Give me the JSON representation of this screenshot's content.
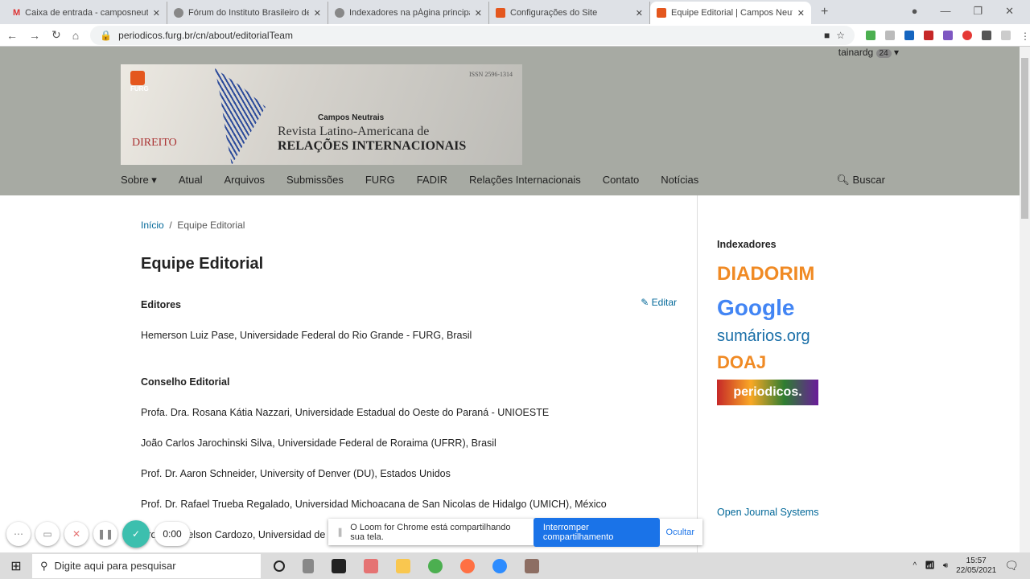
{
  "browser": {
    "tabs": [
      {
        "title": "Caixa de entrada - camposneutr",
        "icon": "gmail-icon"
      },
      {
        "title": "Fórum do Instituto Brasileiro de",
        "icon": "forum-icon"
      },
      {
        "title": "Indexadores na pÁgina principal",
        "icon": "forum-icon"
      },
      {
        "title": "Configurações do Site",
        "icon": "ojs-icon"
      },
      {
        "title": "Equipe Editorial | Campos Neutra",
        "icon": "ojs-icon",
        "active": true
      }
    ],
    "url": "periodicos.furg.br/cn/about/editorialTeam"
  },
  "site": {
    "user": "tainardg",
    "user_badge": "24",
    "banner": {
      "issn": "ISSN 2596-1314",
      "line1": "Campos Neutrais",
      "line2": "Revista Latino-Americana de",
      "line3": "RELAÇÕES INTERNACIONAIS",
      "furg": "FURG",
      "direito": "DIREITO"
    },
    "menu": [
      "Sobre ▾",
      "Atual",
      "Arquivos",
      "Submissões",
      "FURG",
      "FADIR",
      "Relações Internacionais",
      "Contato",
      "Notícias"
    ],
    "search": "Buscar"
  },
  "content": {
    "breadcrumb_home": "Início",
    "breadcrumb_sep": "/",
    "breadcrumb_current": "Equipe Editorial",
    "title": "Equipe Editorial",
    "edit": "Editar",
    "editors_heading": "Editores",
    "editors": [
      "Hemerson Luiz Pase, Universidade Federal do Rio Grande - FURG, Brasil"
    ],
    "board_heading": "Conselho Editorial",
    "board": [
      "Profa. Dra. Rosana Kátia Nazzari, Universidade Estadual do Oeste do Paraná - UNIOESTE",
      "João Carlos Jarochinski Silva, Universidade Federal de Roraima (UFRR), Brasil",
      "Prof. Dr. Aaron Schneider, University of Denver (DU), Estados Unidos",
      "Prof. Dr. Rafael Trueba Regalado, Universidad Michoacana de San Nicolas de Hidalgo (UMICH), México",
      "Prof. Dr. Nelson Cardozo, Universidad de"
    ]
  },
  "sidebar": {
    "heading": "Indexadores",
    "logos": [
      "DIADORIM",
      "Google Acadêmico",
      "sumários.org",
      "DOAJ",
      "periodicos."
    ],
    "ojs": "Open Journal Systems"
  },
  "loom": {
    "time": "0:00",
    "message": "O Loom for Chrome está compartilhando sua tela.",
    "stop": "Interromper compartilhamento",
    "hide": "Ocultar"
  },
  "taskbar": {
    "search_placeholder": "Digite aqui para pesquisar",
    "time": "15:57",
    "date": "22/05/2021"
  }
}
